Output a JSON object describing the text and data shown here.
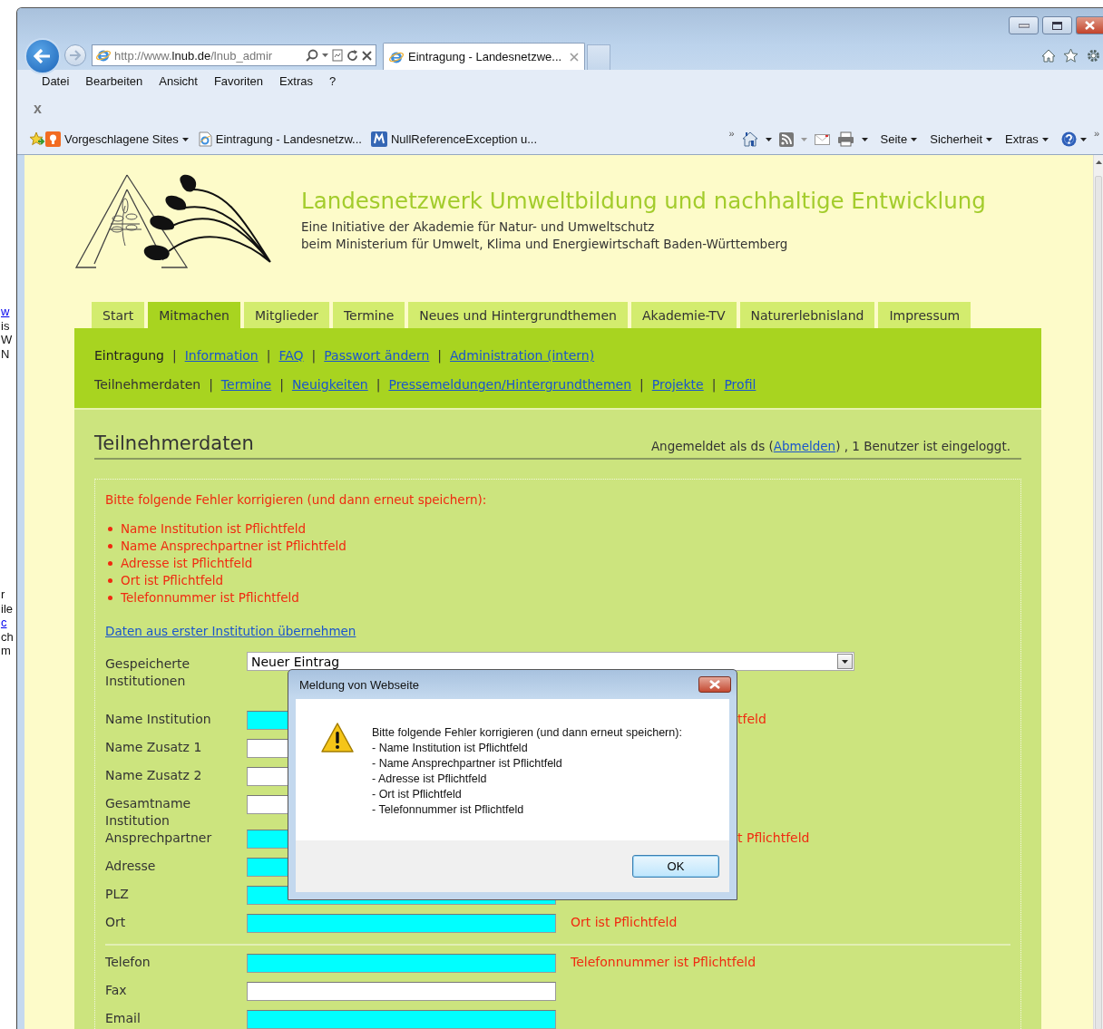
{
  "background_window": {
    "texts": [
      {
        "text": "w",
        "kind": "link"
      },
      {
        "text": "is",
        "kind": "text"
      },
      {
        "text": "W",
        "kind": "text"
      },
      {
        "text": "N",
        "kind": "text"
      },
      {
        "text": "r",
        "kind": "gap"
      },
      {
        "text": "ile",
        "kind": "text"
      },
      {
        "text": "c",
        "kind": "link"
      },
      {
        "text": "ch",
        "kind": "text"
      },
      {
        "text": "m",
        "kind": "text"
      }
    ]
  },
  "browser": {
    "address": "http://www.**lnub.de**/lnub_admir",
    "tabs": [
      {
        "title": "Eintragung - Landesnetzwe...",
        "selected": true
      }
    ],
    "menu": [
      "Datei",
      "Bearbeiten",
      "Ansicht",
      "Favoriten",
      "Extras",
      "?"
    ],
    "toolbar_close": "x",
    "favorites": [
      {
        "label": "Vorgeschlagene Sites",
        "kind": "suggested"
      },
      {
        "label": "Eintragung - Landesnetzw...",
        "kind": "page"
      },
      {
        "label": "NullReferenceException u...",
        "kind": "tile"
      }
    ],
    "overflow": "»",
    "command_bar": [
      "Seite",
      "Sicherheit",
      "Extras"
    ],
    "overflow_right": "»"
  },
  "page": {
    "site_title": "Landesnetzwerk Umweltbildung und nachhaltige Entwicklung",
    "subtitle_lines": [
      "Eine Initiative der Akademie für Natur- und Umweltschutz",
      "beim Ministerium für Umwelt, Klima und Energiewirtschaft Baden-Württemberg"
    ],
    "tabs": [
      {
        "label": "Start",
        "selected": false
      },
      {
        "label": "Mitmachen",
        "selected": true
      },
      {
        "label": "Mitglieder",
        "selected": false
      },
      {
        "label": "Termine",
        "selected": false
      },
      {
        "label": "Neues und Hintergrundthemen",
        "selected": false
      },
      {
        "label": "Akademie-TV",
        "selected": false
      },
      {
        "label": "Naturerlebnisland",
        "selected": false
      },
      {
        "label": "Impressum",
        "selected": false
      }
    ],
    "subnav": [
      [
        {
          "kind": "link",
          "label": "Eintragung",
          "selected": true
        },
        {
          "kind": "separator",
          "label": "|"
        },
        {
          "kind": "link",
          "label": "Information",
          "selected": false
        },
        {
          "kind": "separator",
          "label": "|"
        },
        {
          "kind": "link",
          "label": "FAQ",
          "selected": false
        },
        {
          "kind": "separator",
          "label": "|"
        },
        {
          "kind": "link",
          "label": "Passwort ändern",
          "selected": false
        },
        {
          "kind": "separator",
          "label": "|"
        },
        {
          "kind": "link",
          "label": "Administration (intern)",
          "selected": false
        }
      ],
      [
        {
          "kind": "link",
          "label": "Teilnehmerdaten",
          "selected": true
        },
        {
          "kind": "separator",
          "label": "|"
        },
        {
          "kind": "link",
          "label": "Termine",
          "selected": false
        },
        {
          "kind": "separator",
          "label": "|"
        },
        {
          "kind": "link",
          "label": "Neuigkeiten",
          "selected": false
        },
        {
          "kind": "separator",
          "label": "|"
        },
        {
          "kind": "link",
          "label": "Pressemeldungen/Hintergrundthemen",
          "selected": false
        },
        {
          "kind": "separator",
          "label": "|"
        },
        {
          "kind": "link",
          "label": "Projekte",
          "selected": false
        },
        {
          "kind": "separator",
          "label": "|"
        },
        {
          "kind": "link",
          "label": "Profil",
          "selected": false
        }
      ]
    ],
    "heading": "Teilnehmerdaten",
    "login_status": {
      "before": "Angemeldet als ds (",
      "link": "Abmelden",
      "after": ") , 1 Benutzer ist eingeloggt."
    },
    "errors": {
      "title": "Bitte folgende Fehler korrigieren (und dann erneut speichern):",
      "items": [
        "Name Institution ist Pflichtfeld",
        "Name Ansprechpartner ist Pflichtfeld",
        "Adresse ist Pflichtfeld",
        "Ort ist Pflichtfeld",
        "Telefonnummer ist Pflichtfeld"
      ]
    },
    "copy_link": "Daten aus erster Institution übernehmen",
    "fields": [
      {
        "label": "Gespeicherte Institutionen",
        "kind": "select",
        "value": "Neuer Eintrag"
      },
      {
        "label": "Name Institution",
        "kind": "text",
        "required": true,
        "error": "tfeld",
        "error_covered": true
      },
      {
        "label": "Name Zusatz 1",
        "kind": "text",
        "required": false
      },
      {
        "label": "Name Zusatz 2",
        "kind": "text",
        "required": false
      },
      {
        "label": "Gesamtname Institution",
        "kind": "text",
        "required": false
      },
      {
        "label": "Ansprechpartner",
        "kind": "text",
        "required": true,
        "error": "t Pflichtfeld",
        "error_covered": true
      },
      {
        "label": "Adresse",
        "kind": "text",
        "required": true
      },
      {
        "label": "PLZ",
        "kind": "text",
        "required": true
      },
      {
        "label": "Ort",
        "kind": "text",
        "required": true,
        "error": "Ort ist Pflichtfeld",
        "error_covered": false
      },
      {
        "label": "Telefon",
        "kind": "text",
        "required": true,
        "separator_before": true,
        "error": "Telefonnummer ist Pflichtfeld",
        "error_covered": false
      },
      {
        "label": "Fax",
        "kind": "text",
        "required": false
      },
      {
        "label": "Email",
        "kind": "text",
        "required": true
      }
    ]
  },
  "dialog": {
    "title": "Meldung von Webseite",
    "message_lines": [
      "Bitte folgende Fehler korrigieren (und dann erneut speichern):",
      "- Name Institution ist Pflichtfeld",
      "- Name Ansprechpartner ist Pflichtfeld",
      "- Adresse ist Pflichtfeld",
      "- Ort ist Pflichtfeld",
      "- Telefonnummer ist Pflichtfeld"
    ],
    "button": "OK"
  }
}
